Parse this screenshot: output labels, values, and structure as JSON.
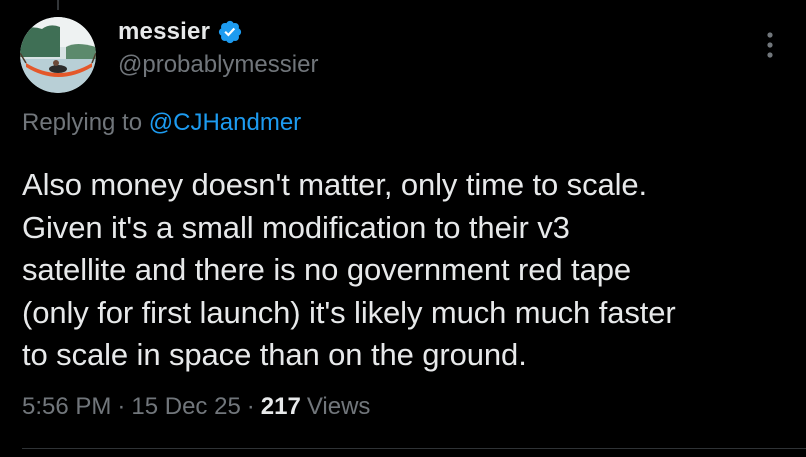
{
  "author": {
    "display_name": "messier",
    "handle": "@probablymessier",
    "verified": true,
    "verified_color": "#1d9bf0"
  },
  "reply": {
    "prefix": "Replying to ",
    "mention": "@CJHandmer"
  },
  "tweet": {
    "text": "Also money doesn't matter, only time to scale.\nGiven it's a small modification to their v3\nsatellite and there is no government red tape\n(only for first launch) it's likely much much faster\nto scale in space than on the ground."
  },
  "meta": {
    "time": "5:56 PM",
    "separator": "·",
    "date": "15 Dec 25",
    "views_count": "217",
    "views_label": "Views"
  },
  "icons": {
    "verified": "verified-badge-icon",
    "more": "more-options-icon"
  },
  "colors": {
    "background": "#000000",
    "primary_text": "#e7e9ea",
    "secondary_text": "#71767b",
    "accent": "#1d9bf0"
  }
}
